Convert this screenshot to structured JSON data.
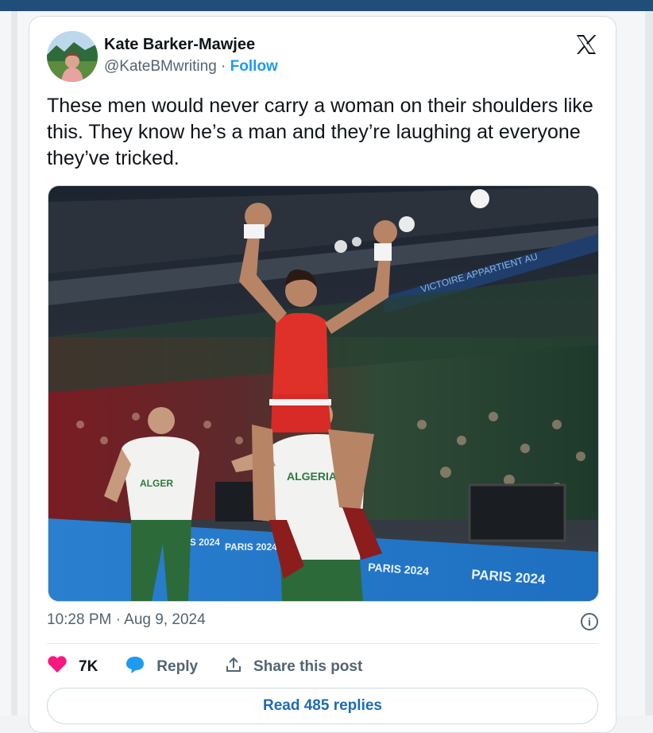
{
  "post": {
    "author_name": "Kate Barker-Mawjee",
    "handle": "@KateBMwriting",
    "separator": " · ",
    "follow_label": "Follow",
    "text": "These men would never carry a woman on their shoulders like this. They know he’s a man and they’re laughing at everyone they’ve tricked.",
    "timestamp": "10:28 PM · Aug 9, 2024"
  },
  "photo": {
    "banner_1": "PARIS 2024",
    "banner_2": "PARIS 2024",
    "banner_3": "PARIS 2024",
    "banner_4": "PARIS 2024",
    "jersey_left": "ALGER",
    "jersey_center": "ALGERIA",
    "upper_banner": "VICTOIRE APPARTIENT AU"
  },
  "actions": {
    "like_count": "7K",
    "reply_label": "Reply",
    "share_label": "Share this post"
  },
  "read_replies_label": "Read 485 replies",
  "colors": {
    "like": "#f91880",
    "reply": "#1d9bf0",
    "link": "#1d9bf0",
    "button_text": "#1d6bb5"
  }
}
